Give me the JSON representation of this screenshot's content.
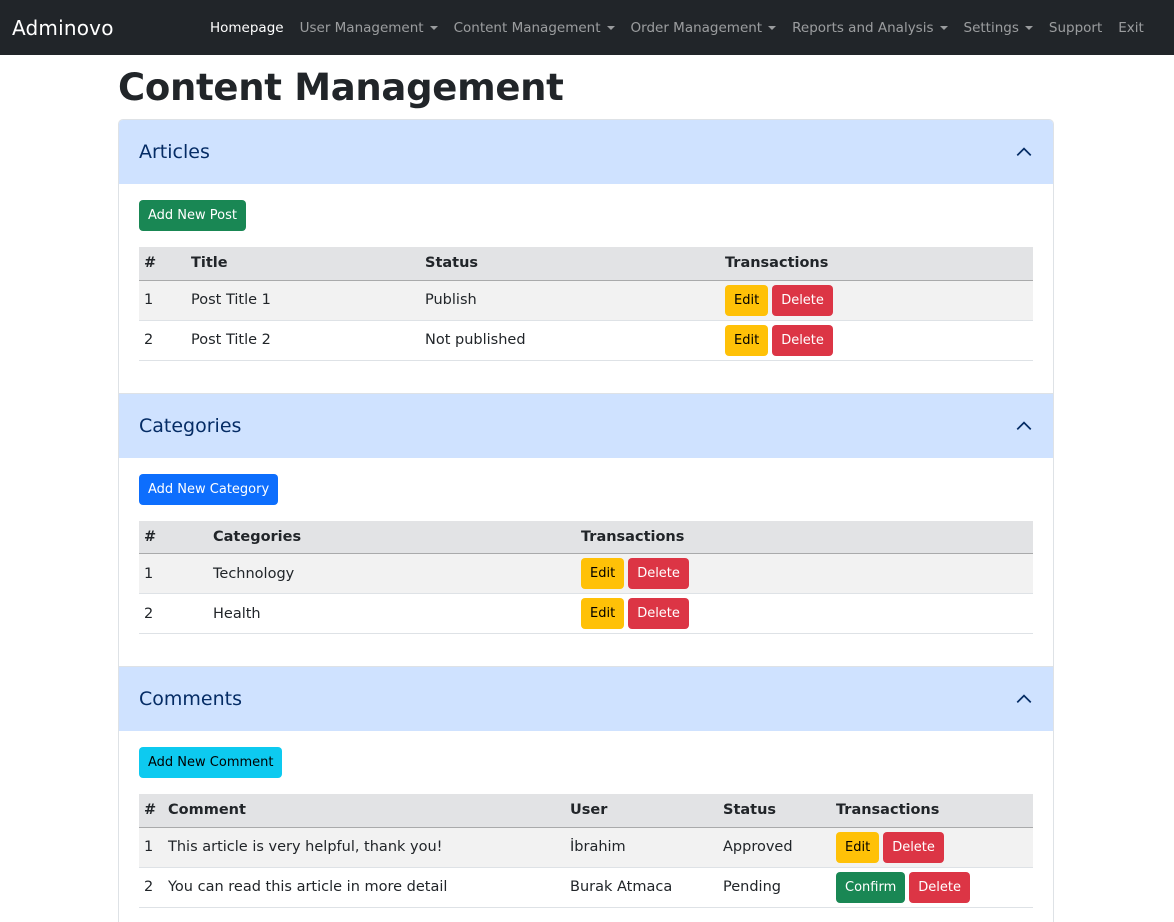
{
  "navbar": {
    "brand": "Adminovo",
    "items": [
      {
        "label": "Homepage"
      },
      {
        "label": "User Management"
      },
      {
        "label": "Content Management"
      },
      {
        "label": "Order Management"
      },
      {
        "label": "Reports and Analysis"
      },
      {
        "label": "Settings"
      },
      {
        "label": "Support"
      },
      {
        "label": "Exit"
      }
    ]
  },
  "page": {
    "title": "Content Management"
  },
  "articles": {
    "header": "Articles",
    "add_label": "Add New Post",
    "columns": [
      "#",
      "Title",
      "Status",
      "Transactions"
    ],
    "rows": [
      {
        "num": "1",
        "title": "Post Title 1",
        "status": "Publish",
        "edit": "Edit",
        "delete": "Delete"
      },
      {
        "num": "2",
        "title": "Post Title 2",
        "status": "Not published",
        "edit": "Edit",
        "delete": "Delete"
      }
    ]
  },
  "categories": {
    "header": "Categories",
    "add_label": "Add New Category",
    "columns": [
      "#",
      "Categories",
      "Transactions"
    ],
    "rows": [
      {
        "num": "1",
        "name": "Technology",
        "edit": "Edit",
        "delete": "Delete"
      },
      {
        "num": "2",
        "name": "Health",
        "edit": "Edit",
        "delete": "Delete"
      }
    ]
  },
  "comments": {
    "header": "Comments",
    "add_label": "Add New Comment",
    "columns": [
      "#",
      "Comment",
      "User",
      "Status",
      "Transactions"
    ],
    "rows": [
      {
        "num": "1",
        "comment": "This article is very helpful, thank you!",
        "user": "İbrahim",
        "status": "Approved",
        "action": "Edit",
        "delete": "Delete"
      },
      {
        "num": "2",
        "comment": "You can read this article in more detail",
        "user": "Burak Atmaca",
        "status": "Pending",
        "action": "Confirm",
        "delete": "Delete"
      }
    ]
  },
  "icons": {
    "accordion_toggle": "chevron-up-icon"
  },
  "colors": {
    "navbar_bg": "#212529",
    "accordion_header_bg": "#cfe2ff",
    "success": "#198754",
    "primary": "#0d6efd",
    "info": "#0dcaf0",
    "warning": "#ffc107",
    "danger": "#dc3545"
  }
}
